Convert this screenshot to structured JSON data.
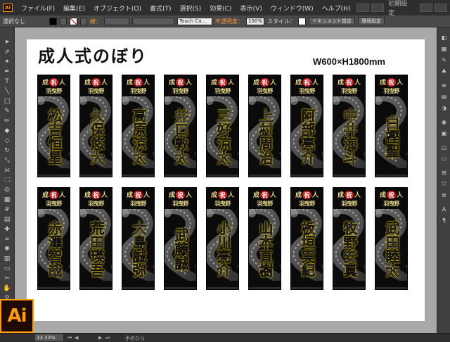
{
  "menubar": {
    "logo_text": "Ai",
    "menus": [
      "ファイル(F)",
      "編集(E)",
      "オブジェクト(O)",
      "書式(T)",
      "選択(S)",
      "効果(C)",
      "表示(V)",
      "ウィンドウ(W)",
      "ヘルプ(H)"
    ],
    "workspace": "初期設定"
  },
  "controlbar": {
    "selection": "選択なし",
    "stroke_label": "線：",
    "brush": "Touch Ca...",
    "opacity_label": "不透明度：",
    "opacity_value": "100%",
    "style_label": "スタイル：",
    "document_setup": "ドキュメント設定",
    "preferences": "環境設定"
  },
  "artboard": {
    "title": "成人式のぼり",
    "size": "W600×H1800mm"
  },
  "banner_header": {
    "left": "成",
    "badge": "祝",
    "right": "人",
    "org": "羽曳野"
  },
  "banners": [
    {
      "name": "松吉恒星"
    },
    {
      "name": "久保悠大"
    },
    {
      "name": "高原涼太"
    },
    {
      "name": "井口敦太"
    },
    {
      "name": "三好涼太"
    },
    {
      "name": "上村周治"
    },
    {
      "name": "阿部亮介"
    },
    {
      "name": "中井海斗"
    },
    {
      "name": "白樫聖"
    },
    {
      "name": "赤澤智哉"
    },
    {
      "name": "荒田瑛吾"
    },
    {
      "name": "大島誠弥"
    },
    {
      "name": "武藤誠"
    },
    {
      "name": "小川亮介"
    },
    {
      "name": "山本直樹"
    },
    {
      "name": "板垣実紀"
    },
    {
      "name": "牧野安真"
    },
    {
      "name": "武田睦太"
    }
  ],
  "statusbar": {
    "zoom": "33.33%",
    "tool_status": "手のひら"
  },
  "colors": {
    "app_accent": "#ff9a00",
    "banner_background": "#0b0b0b",
    "name_glow": "#ffd800",
    "badge_red": "#d61a1a",
    "header_gold": "#e8d78a"
  }
}
